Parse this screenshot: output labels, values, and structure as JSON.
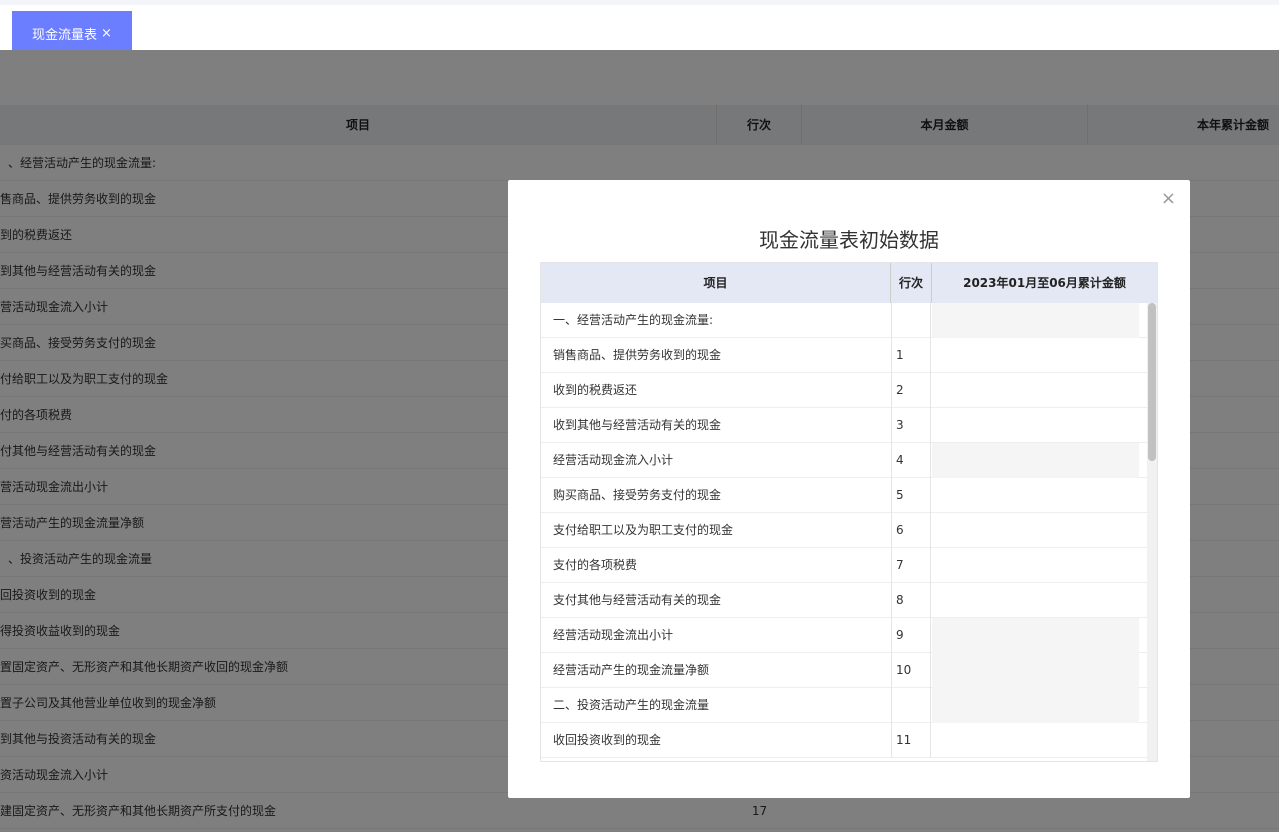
{
  "tab": {
    "label": "现金流量表",
    "close": "×"
  },
  "background_table": {
    "headers": [
      "项目",
      "行次",
      "本月金额",
      "本年累计金额"
    ],
    "rows": [
      {
        "item": "、经营活动产生的现金流量:",
        "no": ""
      },
      {
        "item": "售商品、提供劳务收到的现金",
        "no": ""
      },
      {
        "item": "到的税费返还",
        "no": ""
      },
      {
        "item": "到其他与经营活动有关的现金",
        "no": ""
      },
      {
        "item": "营活动现金流入小计",
        "no": ""
      },
      {
        "item": "买商品、接受劳务支付的现金",
        "no": ""
      },
      {
        "item": "付给职工以及为职工支付的现金",
        "no": ""
      },
      {
        "item": "付的各项税费",
        "no": ""
      },
      {
        "item": "付其他与经营活动有关的现金",
        "no": ""
      },
      {
        "item": "营活动现金流出小计",
        "no": ""
      },
      {
        "item": "营活动产生的现金流量净额",
        "no": ""
      },
      {
        "item": "、投资活动产生的现金流量",
        "no": ""
      },
      {
        "item": "回投资收到的现金",
        "no": ""
      },
      {
        "item": "得投资收益收到的现金",
        "no": ""
      },
      {
        "item": "置固定资产、无形资产和其他长期资产收回的现金净额",
        "no": ""
      },
      {
        "item": "置子公司及其他营业单位收到的现金净额",
        "no": ""
      },
      {
        "item": "到其他与投资活动有关的现金",
        "no": ""
      },
      {
        "item": "资活动现金流入小计",
        "no": ""
      },
      {
        "item": "建固定资产、无形资产和其他长期资产所支付的现金",
        "no": "17"
      }
    ]
  },
  "modal": {
    "title": "现金流量表初始数据",
    "close": "×",
    "headers": [
      "项目",
      "行次",
      "2023年01月至06月累计金额"
    ],
    "rows": [
      {
        "item": "一、经营活动产生的现金流量:",
        "no": "",
        "gray": true
      },
      {
        "item": "销售商品、提供劳务收到的现金",
        "no": "1",
        "gray": false
      },
      {
        "item": "收到的税费返还",
        "no": "2",
        "gray": false
      },
      {
        "item": "收到其他与经营活动有关的现金",
        "no": "3",
        "gray": false
      },
      {
        "item": "经营活动现金流入小计",
        "no": "4",
        "gray": true
      },
      {
        "item": "购买商品、接受劳务支付的现金",
        "no": "5",
        "gray": false
      },
      {
        "item": "支付给职工以及为职工支付的现金",
        "no": "6",
        "gray": false
      },
      {
        "item": "支付的各项税费",
        "no": "7",
        "gray": false
      },
      {
        "item": "支付其他与经营活动有关的现金",
        "no": "8",
        "gray": false
      },
      {
        "item": "经营活动现金流出小计",
        "no": "9",
        "gray": true
      },
      {
        "item": "经营活动产生的现金流量净额",
        "no": "10",
        "gray": true
      },
      {
        "item": "二、投资活动产生的现金流量",
        "no": "",
        "gray": true
      },
      {
        "item": "收回投资收到的现金",
        "no": "11",
        "gray": false
      }
    ]
  }
}
